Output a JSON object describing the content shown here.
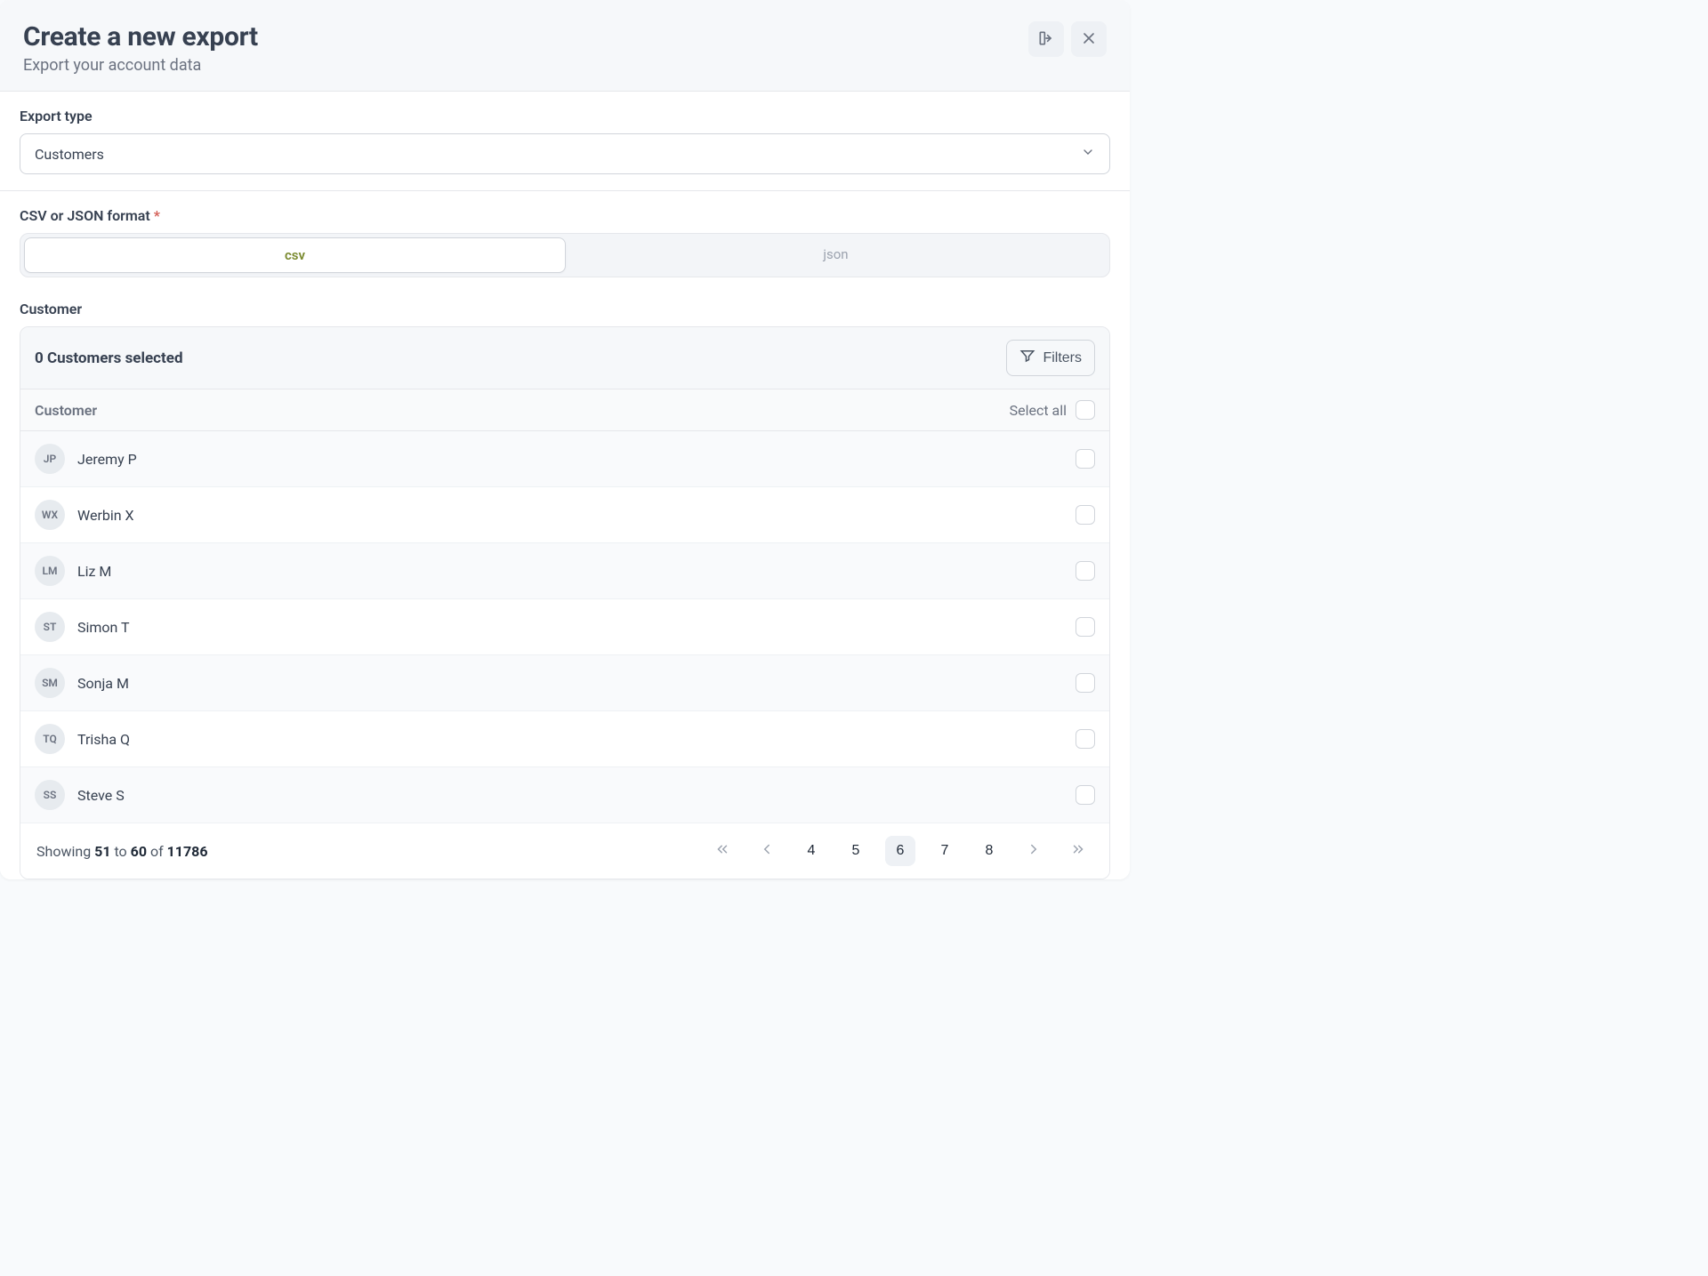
{
  "header": {
    "title": "Create a new export",
    "subtitle": "Export your account data"
  },
  "export_type": {
    "label": "Export type",
    "value": "Customers"
  },
  "format": {
    "label": "CSV or JSON format",
    "options": {
      "csv": "csv",
      "json": "json"
    }
  },
  "customer_section": {
    "label": "Customer",
    "selected_text": "0 Customers selected",
    "filters_label": "Filters",
    "column_label": "Customer",
    "select_all_label": "Select all"
  },
  "customers": [
    {
      "initials": "JP",
      "name": "Jeremy P"
    },
    {
      "initials": "WX",
      "name": "Werbin X"
    },
    {
      "initials": "LM",
      "name": "Liz M"
    },
    {
      "initials": "ST",
      "name": "Simon T"
    },
    {
      "initials": "SM",
      "name": "Sonja M"
    },
    {
      "initials": "TQ",
      "name": "Trisha Q"
    },
    {
      "initials": "SS",
      "name": "Steve S"
    }
  ],
  "pagination": {
    "showing": "Showing",
    "from": "51",
    "to_word": "to",
    "to": "60",
    "of_word": "of",
    "total": "11786",
    "pages": [
      "4",
      "5",
      "6",
      "7",
      "8"
    ],
    "active_page": "6"
  }
}
